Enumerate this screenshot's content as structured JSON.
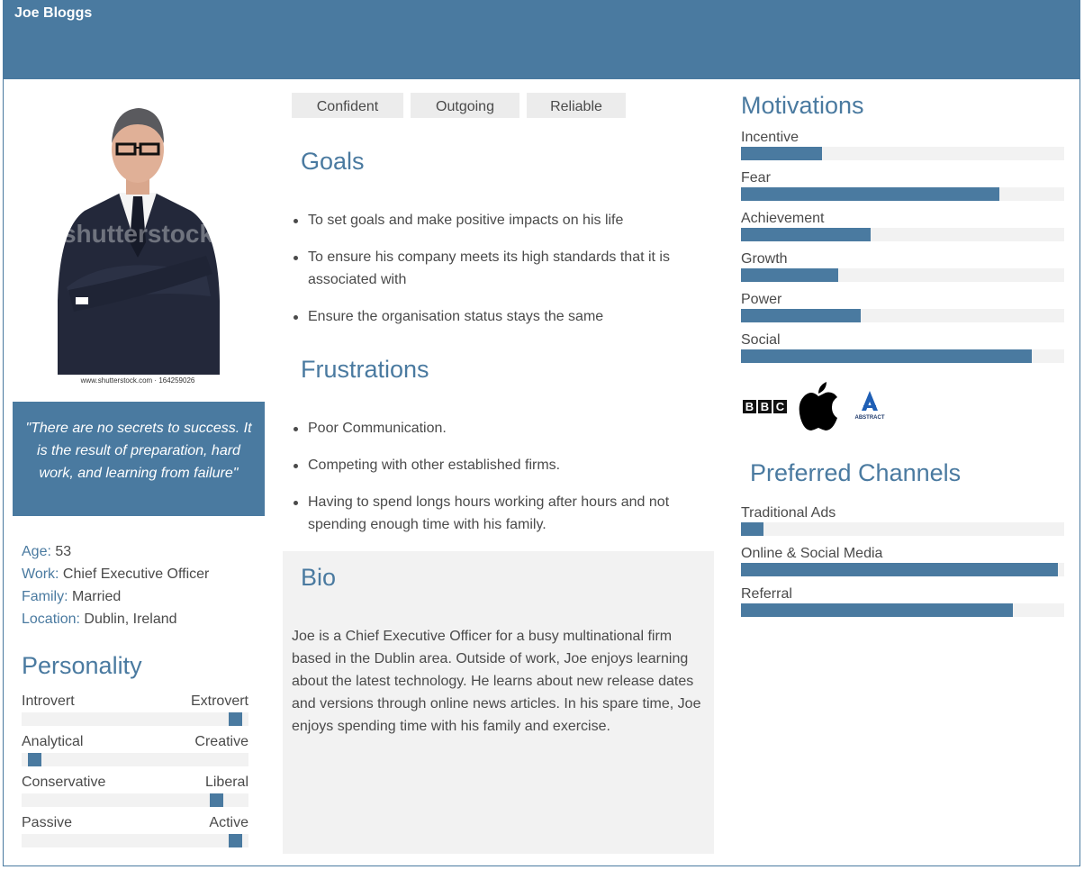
{
  "persona": {
    "name": "Joe Bloggs",
    "photo_watermark": "shutterstock",
    "photo_caption": "www.shutterstock.com · 164259026",
    "quote": "\"There are no secrets to success. It is the result of preparation, hard work, and learning from failure\"",
    "facts": [
      {
        "key": "Age:",
        "value": " 53"
      },
      {
        "key": "Work:",
        "value": " Chief Executive Officer"
      },
      {
        "key": "Family:",
        "value": " Married"
      },
      {
        "key": "Location:",
        "value": " Dublin, Ireland"
      }
    ]
  },
  "personality": {
    "title": "Personality",
    "scales": [
      {
        "left": "Introvert",
        "right": "Extrovert",
        "level": 0.97
      },
      {
        "left": "Analytical",
        "right": "Creative",
        "level": 0.03
      },
      {
        "left": "Conservative",
        "right": "Liberal",
        "level": 0.88
      },
      {
        "left": "Passive",
        "right": "Active",
        "level": 0.97
      }
    ]
  },
  "traits": [
    "Confident",
    "Outgoing",
    "Reliable"
  ],
  "goals": {
    "title": "Goals",
    "items": [
      "To set goals and make positive impacts on his life",
      "To ensure his company meets its high standards that it is associated with",
      "Ensure the organisation status stays the same"
    ]
  },
  "frustrations": {
    "title": "Frustrations",
    "items": [
      "Poor Communication.",
      "Competing with other established firms.",
      "Having to spend longs hours working after hours and not spending enough time with his family."
    ]
  },
  "bio": {
    "title": "Bio",
    "text": "Joe is a Chief Executive Officer for a busy multinational firm based in the Dublin area. Outside of work, Joe enjoys learning about the latest technology. He learns about new release dates and versions through online news articles. In his spare time, Joe enjoys spending time with his family and exercise."
  },
  "motivations": {
    "title": "Motivations",
    "items": [
      {
        "label": "Incentive",
        "level": 0.25
      },
      {
        "label": "Fear",
        "level": 0.8
      },
      {
        "label": "Achievement",
        "level": 0.4
      },
      {
        "label": "Growth",
        "level": 0.3
      },
      {
        "label": "Power",
        "level": 0.37
      },
      {
        "label": "Social",
        "level": 0.9
      }
    ]
  },
  "brands": [
    {
      "name": "BBC",
      "icon": "bbc-logo"
    },
    {
      "name": "Apple",
      "icon": "apple-logo"
    },
    {
      "name": "ABSTRACT",
      "icon": "abstract-logo"
    }
  ],
  "channels": {
    "title": "Preferred Channels",
    "items": [
      {
        "label": "Traditional Ads",
        "level": 0.07
      },
      {
        "label": "Online & Social Media",
        "level": 0.98
      },
      {
        "label": "Referral",
        "level": 0.84
      }
    ]
  },
  "colors": {
    "accent": "#4a7aa0",
    "track": "#f2f2f2",
    "tag_bg": "#ececec"
  }
}
